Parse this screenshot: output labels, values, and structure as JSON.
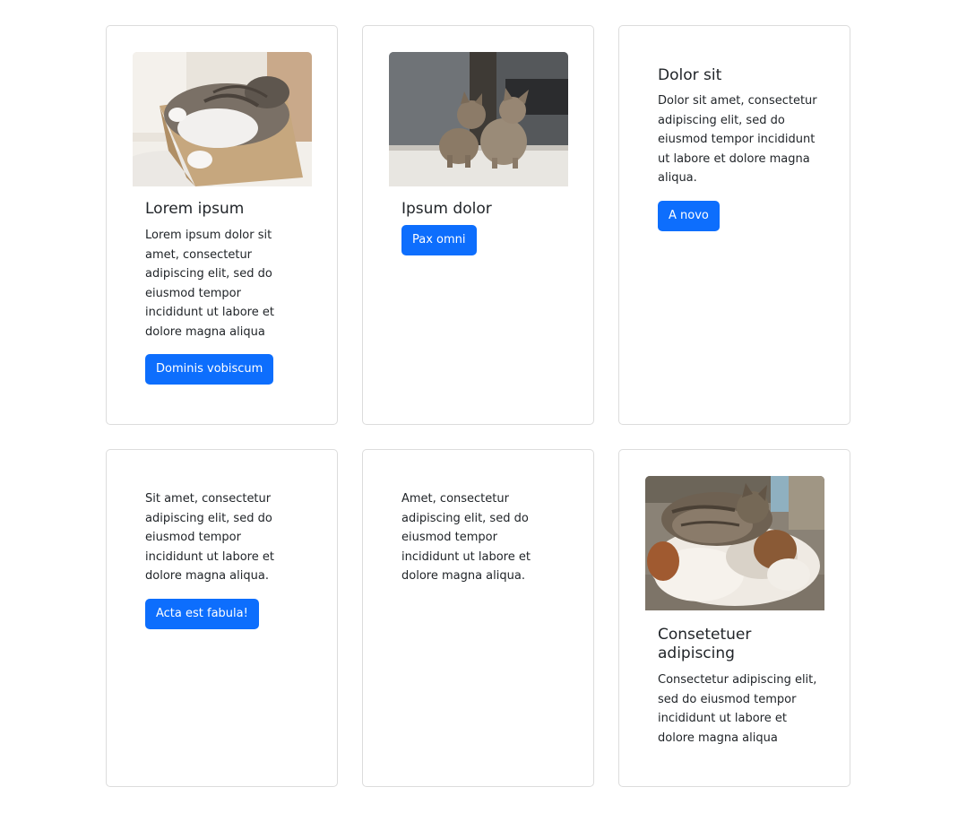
{
  "cards": [
    {
      "title": "Lorem ipsum",
      "text": "Lorem ipsum dolor sit amet, consectetur adipiscing elit, sed do eiusmod tempor incididunt ut labore et dolore magna aliqua",
      "button": "Dominis vobiscum"
    },
    {
      "title": "Ipsum dolor",
      "button": "Pax omni"
    },
    {
      "title": "Dolor sit",
      "text": "Dolor sit amet, consectetur adipiscing elit, sed do eiusmod tempor incididunt ut labore et dolore magna aliqua.",
      "button": "A novo"
    },
    {
      "text": "Sit amet, consectetur adipiscing elit, sed do eiusmod tempor incididunt ut labore et dolore magna aliqua.",
      "button": "Acta est fabula!"
    },
    {
      "text": "Amet, consectetur adipiscing elit, sed do eiusmod tempor incididunt ut labore et dolore magna aliqua."
    },
    {
      "title": "Consetetuer adipiscing",
      "text": "Consectetur adipiscing elit, sed do eiusmod tempor incididunt ut labore et dolore magna aliqua"
    }
  ],
  "colors": {
    "button": "#0d6efd",
    "button_text": "#ffffff",
    "card_border": "#dcdcdc",
    "text": "#212529"
  }
}
